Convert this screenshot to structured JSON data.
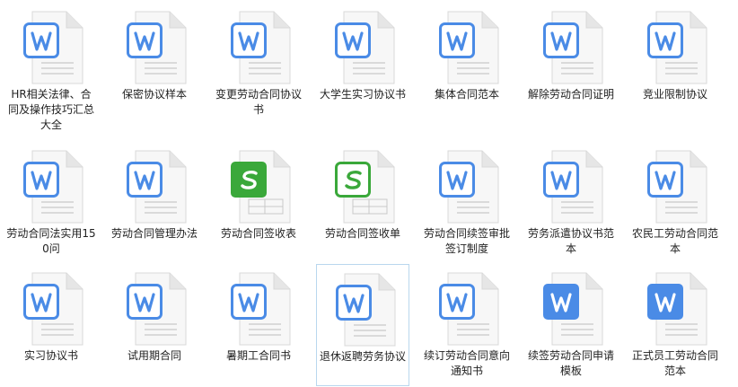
{
  "files": [
    {
      "name": "HR相关法律、合同及操作技巧汇总大全",
      "type": "doc"
    },
    {
      "name": "保密协议样本",
      "type": "doc"
    },
    {
      "name": "变更劳动合同协议书",
      "type": "doc"
    },
    {
      "name": "大学生实习协议书",
      "type": "doc"
    },
    {
      "name": "集体合同范本",
      "type": "doc"
    },
    {
      "name": "解除劳动合同证明",
      "type": "doc"
    },
    {
      "name": "竞业限制协议",
      "type": "doc"
    },
    {
      "name": "劳动合同法实用150问",
      "type": "doc"
    },
    {
      "name": "劳动合同管理办法",
      "type": "doc"
    },
    {
      "name": "劳动合同签收表",
      "type": "sheet-filled"
    },
    {
      "name": "劳动合同签收单",
      "type": "sheet-outline"
    },
    {
      "name": "劳动合同续签审批签订制度",
      "type": "doc"
    },
    {
      "name": "劳务派遣协议书范本",
      "type": "doc"
    },
    {
      "name": "农民工劳动合同范本",
      "type": "doc"
    },
    {
      "name": "实习协议书",
      "type": "doc"
    },
    {
      "name": "试用期合同",
      "type": "doc"
    },
    {
      "name": "暑期工合同书",
      "type": "doc"
    },
    {
      "name": "退休返聘劳务协议",
      "type": "doc",
      "selected": true
    },
    {
      "name": "续订劳动合同意向通知书",
      "type": "doc"
    },
    {
      "name": "续签劳动合同申请模板",
      "type": "doc-solid"
    },
    {
      "name": "正式员工劳动合同范本",
      "type": "doc-solid"
    }
  ],
  "colors": {
    "word_blue": "#4a8be6",
    "sheet_green": "#3aa83a",
    "page_gray": "#f2f2f2",
    "selection_border": "#b9d7ee"
  },
  "icons": {
    "doc": "word-file-icon",
    "doc-solid": "word-file-solid-icon",
    "sheet-filled": "spreadsheet-file-icon",
    "sheet-outline": "spreadsheet-file-outline-icon"
  }
}
